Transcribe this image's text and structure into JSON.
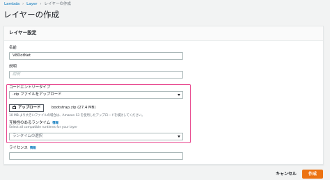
{
  "breadcrumb": [
    "Lambda",
    "Layer",
    "レイヤーの作成"
  ],
  "page_title": "レイヤーの作成",
  "panel": {
    "title": "レイヤー設定",
    "name": {
      "label": "名前",
      "value": "V8DotNet"
    },
    "description": {
      "label": "説明",
      "placeholder": "説明"
    },
    "code_entry": {
      "label": "コードエントリータイプ",
      "selected": ".zip ファイルをアップロード",
      "upload_button": "アップロード",
      "file_name": "bootstrap.zip (27.4 MB)",
      "hint": "10 MB より大きいファイルの場合は、Amazon S3 を使用したアップロードを検討してください。"
    },
    "runtimes": {
      "label": "互換性のあるランタイム",
      "info": "情報",
      "sublabel": "Select all compatible runtimes for your layer",
      "placeholder": "ランタイムの選択"
    },
    "license": {
      "label": "ライセンス",
      "info": "情報",
      "value": ""
    }
  },
  "footer": {
    "cancel": "キャンセル",
    "create": "作成"
  },
  "colors": {
    "link": "#0073bb",
    "highlight": "#e8498f",
    "primary": "#ec7211"
  }
}
